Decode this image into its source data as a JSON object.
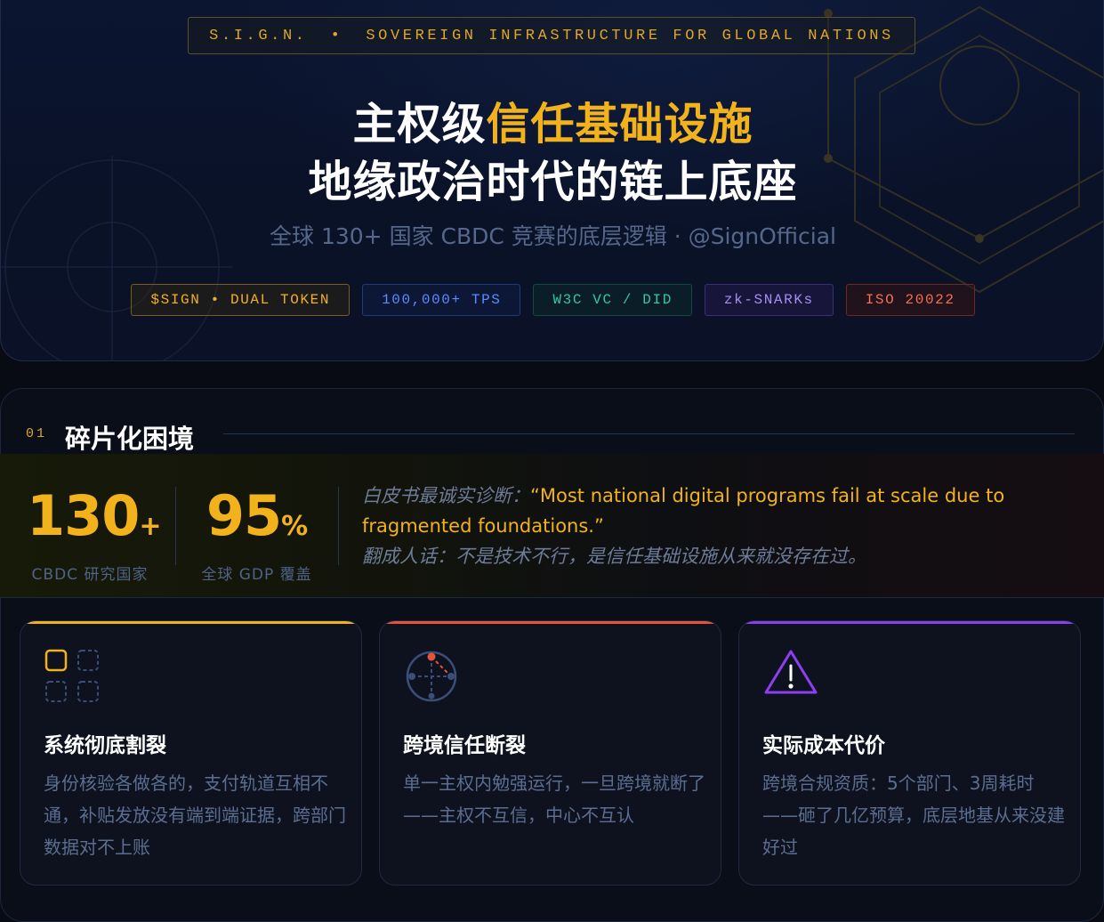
{
  "header": {
    "banner_left": "S.I.G.N.",
    "banner_sep": "•",
    "banner_right": "SOVEREIGN INFRASTRUCTURE FOR GLOBAL NATIONS",
    "title_line1_plain": "主权级",
    "title_line1_accent": "信任基础设施",
    "title_line2": "地缘政治时代的链上底座",
    "subtitle": "全球 130+ 国家 CBDC 竞赛的底层逻辑 · @SignOfficial",
    "tags": [
      "$SIGN • DUAL TOKEN",
      "100,000+ TPS",
      "W3C VC / DID",
      "zk-SNARKs",
      "ISO 20022"
    ]
  },
  "section": {
    "number": "01",
    "title": "碎片化困境",
    "stats": [
      {
        "value": "130",
        "unit": "+",
        "label": "CBDC 研究国家"
      },
      {
        "value": "95",
        "unit": "%",
        "label": "全球 GDP 覆盖"
      }
    ],
    "quote": {
      "lead": "白皮书最诚实诊断：",
      "english_line1": "“Most national digital programs fail at scale due to",
      "english_line2": "fragmented foundations.”",
      "tail": "翻成人话：不是技术不行，是信任基础设施从来就没存在过。"
    },
    "cards": [
      {
        "title": "系统彻底割裂",
        "body": "身份核验各做各的，支付轨道互相不通，补贴发放没有端到端证据，跨部门数据对不上账",
        "icon": "fragmented-grid-icon"
      },
      {
        "title": "跨境信任断裂",
        "body": "单一主权内勉强运行，一旦跨境就断了——主权不互信，中心不互认",
        "icon": "broken-network-icon"
      },
      {
        "title": "实际成本代价",
        "body": "跨境合规资质：5个部门、3周耗时——砸了几亿预算，底层地基从来没建好过",
        "icon": "warning-triangle-icon"
      }
    ]
  },
  "colors": {
    "accent_gold": "#f2b21c",
    "accent_red": "#e2553a",
    "accent_purple": "#8d3ff0",
    "background": "#080b13"
  }
}
